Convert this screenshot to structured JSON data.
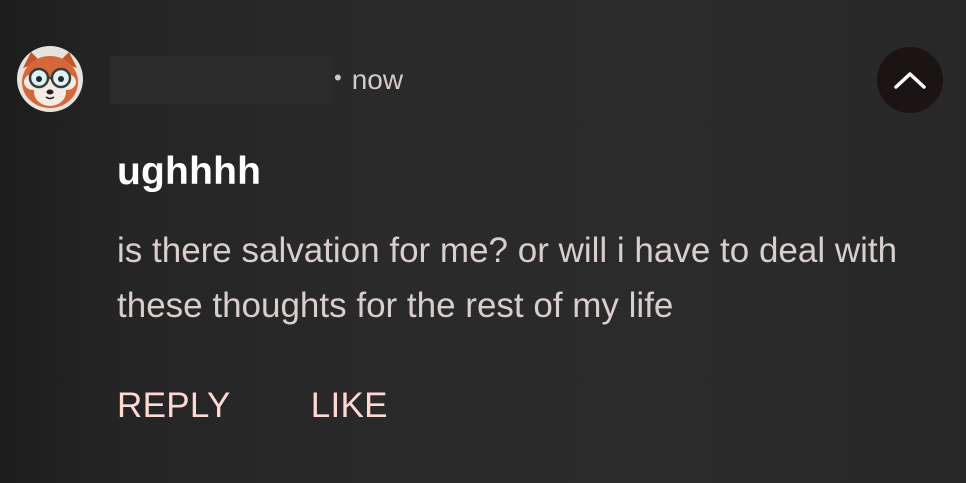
{
  "header": {
    "separator": "•",
    "time": "now"
  },
  "message": {
    "title": "ughhhh",
    "body": "is there salvation for me? or will i have to deal with these thoughts for the rest of my life"
  },
  "actions": {
    "reply_label": "REPLY",
    "like_label": "LIKE"
  },
  "icons": {
    "collapse": "chevron-up-icon",
    "avatar": "red-panda-avatar"
  },
  "colors": {
    "background": "#2a2a2a",
    "action_text": "#ffd8d4",
    "title_text": "#ffffff",
    "body_text": "#d8cfcd",
    "collapse_button_bg": "#1a1414"
  }
}
